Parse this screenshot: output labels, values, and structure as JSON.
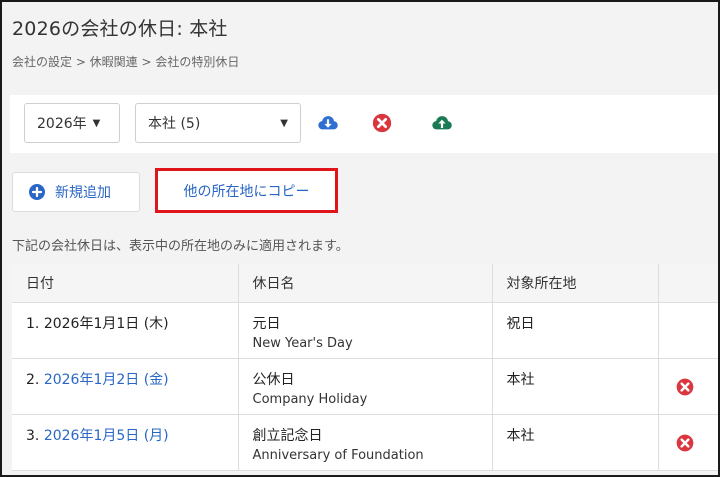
{
  "page": {
    "title": "2026の会社の休日: 本社",
    "breadcrumb": "会社の設定 > 休暇関連 > 会社の特別休日"
  },
  "toolbar": {
    "year_select": "2026年",
    "location_select": "本社 (5)",
    "icons": [
      "download-icon",
      "remove-icon",
      "upload-icon"
    ]
  },
  "actions": {
    "add_label": "新規追加",
    "copy_label": "他の所在地にコピー"
  },
  "note": "下記の会社休日は、表示中の所在地のみに適用されます。",
  "table": {
    "headers": [
      "日付",
      "休日名",
      "対象所在地",
      ""
    ],
    "rows": [
      {
        "num": "1.",
        "date": "2026年1月1日 (木)",
        "name": "元日",
        "name_en": "New Year's Day",
        "location": "祝日",
        "deletable": false
      },
      {
        "num": "2.",
        "date": "2026年1月2日 (金)",
        "name": "公休日",
        "name_en": "Company Holiday",
        "location": "本社",
        "deletable": true
      },
      {
        "num": "3.",
        "date": "2026年1月5日 (月)",
        "name": "創立記念日",
        "name_en": "Anniversary of Foundation",
        "location": "本社",
        "deletable": true
      }
    ]
  },
  "colors": {
    "link": "#2a66c5",
    "delete": "#d9363e",
    "download": "#2f6fd1",
    "upload": "#1a7a55",
    "highlight": "#e0141b"
  }
}
